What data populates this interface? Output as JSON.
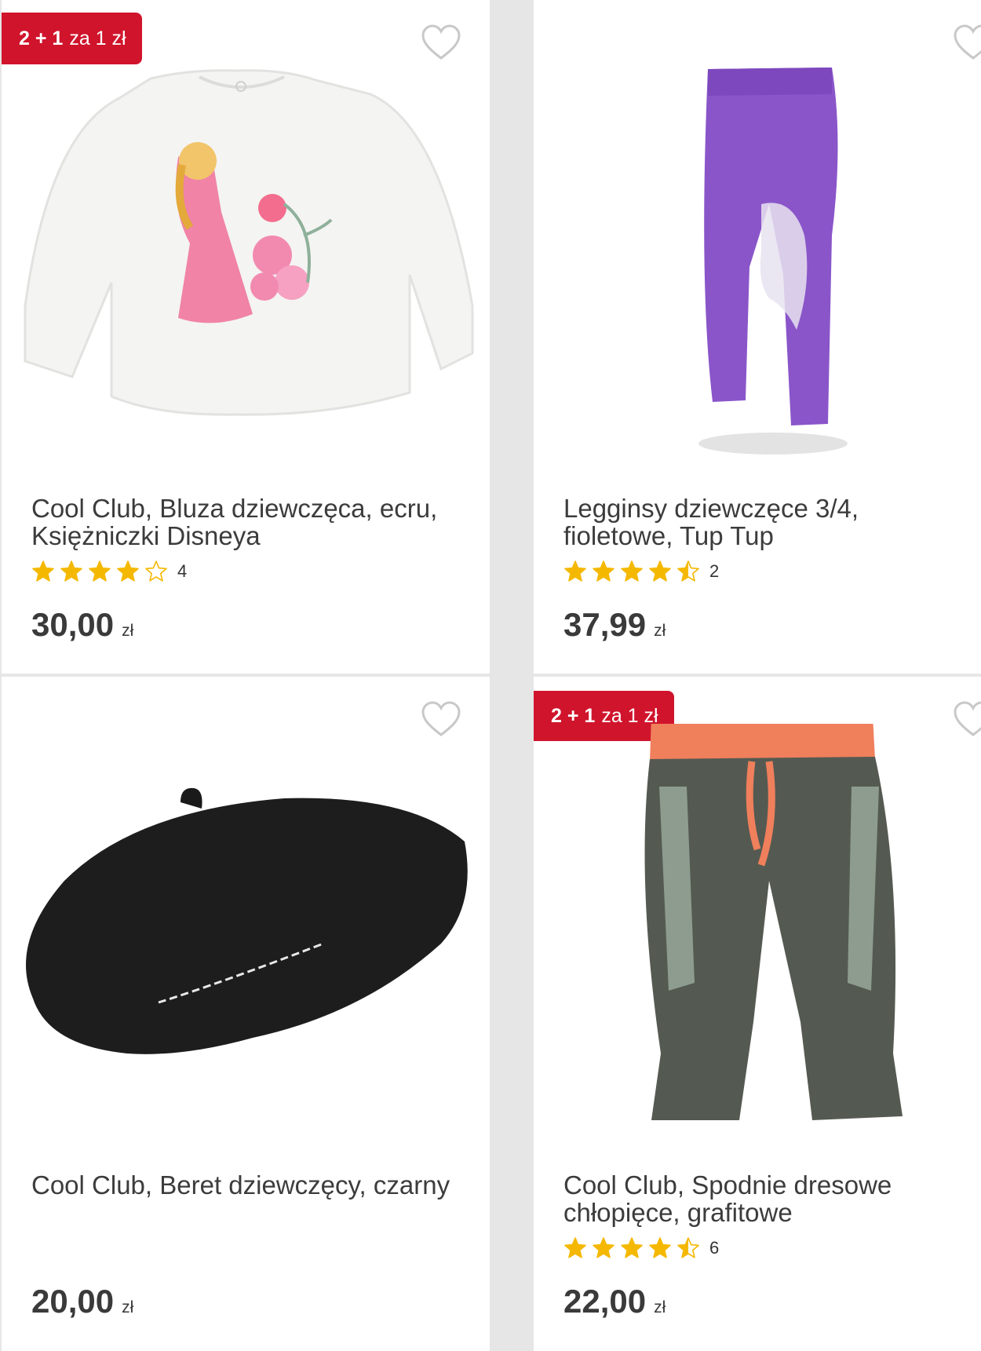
{
  "colors": {
    "badge": "#d0142c",
    "star": "#f5b800",
    "page_bg": "#e6e6e6"
  },
  "products": [
    {
      "badge": {
        "bold": "2 + 1",
        "rest": "za 1 zł"
      },
      "title_line1": "Cool Club, Bluza dziewczęca, ecru,",
      "title_line2": "Księżniczki Disneya",
      "rating": 4,
      "reviews": "4",
      "price": "30,00",
      "currency": "zł"
    },
    {
      "title_line1": "Legginsy dziewczęce 3/4,",
      "title_line2": "fioletowe, Tup Tup",
      "rating": 4.5,
      "reviews": "2",
      "price": "37,99",
      "currency": "zł"
    },
    {
      "title_line1": "Cool Club, Beret dziewczęcy, czarny",
      "title_line2": "",
      "price": "20,00",
      "currency": "zł"
    },
    {
      "badge": {
        "bold": "2 + 1",
        "rest": "za 1 zł"
      },
      "title_line1": "Cool Club, Spodnie dresowe",
      "title_line2": "chłopięce, grafitowe",
      "rating": 4.5,
      "reviews": "6",
      "price": "22,00",
      "currency": "zł"
    }
  ]
}
